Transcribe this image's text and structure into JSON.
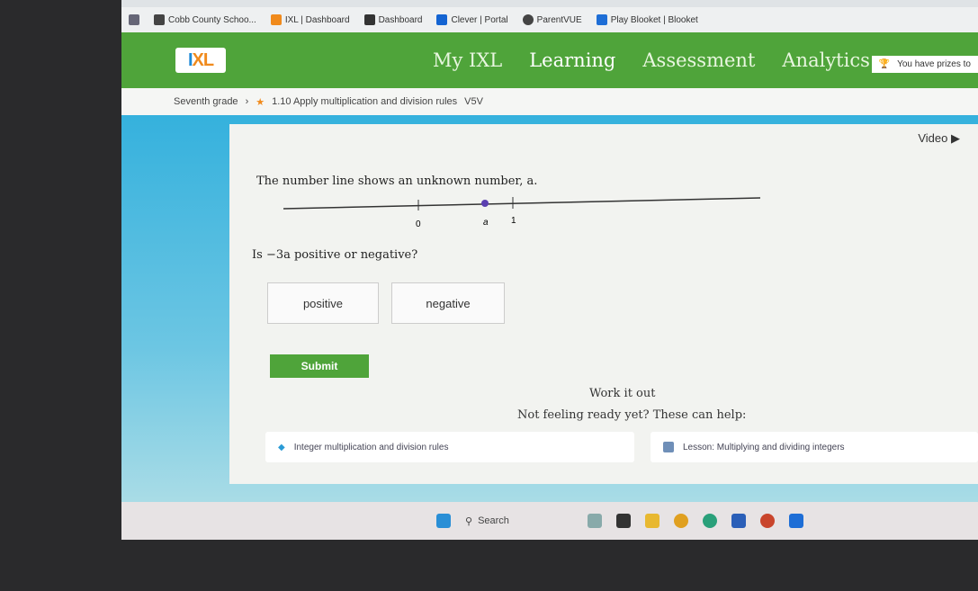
{
  "bookmarks": [
    {
      "label": "Cobb County Schoo...",
      "icon": "cobb-icon",
      "color": "#444"
    },
    {
      "label": "IXL | Dashboard",
      "icon": "ixl-icon",
      "color": "#f08a1c"
    },
    {
      "label": "Dashboard",
      "icon": "dashboard-icon",
      "color": "#333"
    },
    {
      "label": "Clever | Portal",
      "icon": "clever-icon",
      "color": "#1464d2"
    },
    {
      "label": "ParentVUE",
      "icon": "parentvue-icon",
      "color": "#444"
    },
    {
      "label": "Play Blooket | Blooket",
      "icon": "blooket-icon",
      "color": "#1e6ed6"
    }
  ],
  "nav": {
    "logo": "IXL",
    "items": [
      "My IXL",
      "Learning",
      "Assessment",
      "Analytics"
    ],
    "active": "Learning",
    "prizes": "You have prizes to"
  },
  "breadcrumb": {
    "grade": "Seventh grade",
    "skill": "1.10 Apply multiplication and division rules",
    "code": "V5V"
  },
  "question": {
    "video": "Video",
    "text": "The number line shows an unknown number, a.",
    "labels": [
      "0",
      "a",
      "1"
    ],
    "prompt": "Is −3a positive or negative?",
    "choices": [
      "positive",
      "negative"
    ],
    "submit": "Submit"
  },
  "help": {
    "work": "Work it out",
    "not_ready": "Not feeling ready yet? These can help:",
    "links": [
      "Integer multiplication and division rules",
      "Lesson: Multiplying and dividing integers"
    ]
  },
  "taskbar": {
    "search": "Search",
    "apps": [
      "start",
      "widgets",
      "file-explorer",
      "folder",
      "chrome",
      "edge",
      "word",
      "powerpoint",
      "outlook"
    ]
  },
  "colors": {
    "ixl_green": "#4fa43a",
    "sky": "#35b1dd"
  }
}
